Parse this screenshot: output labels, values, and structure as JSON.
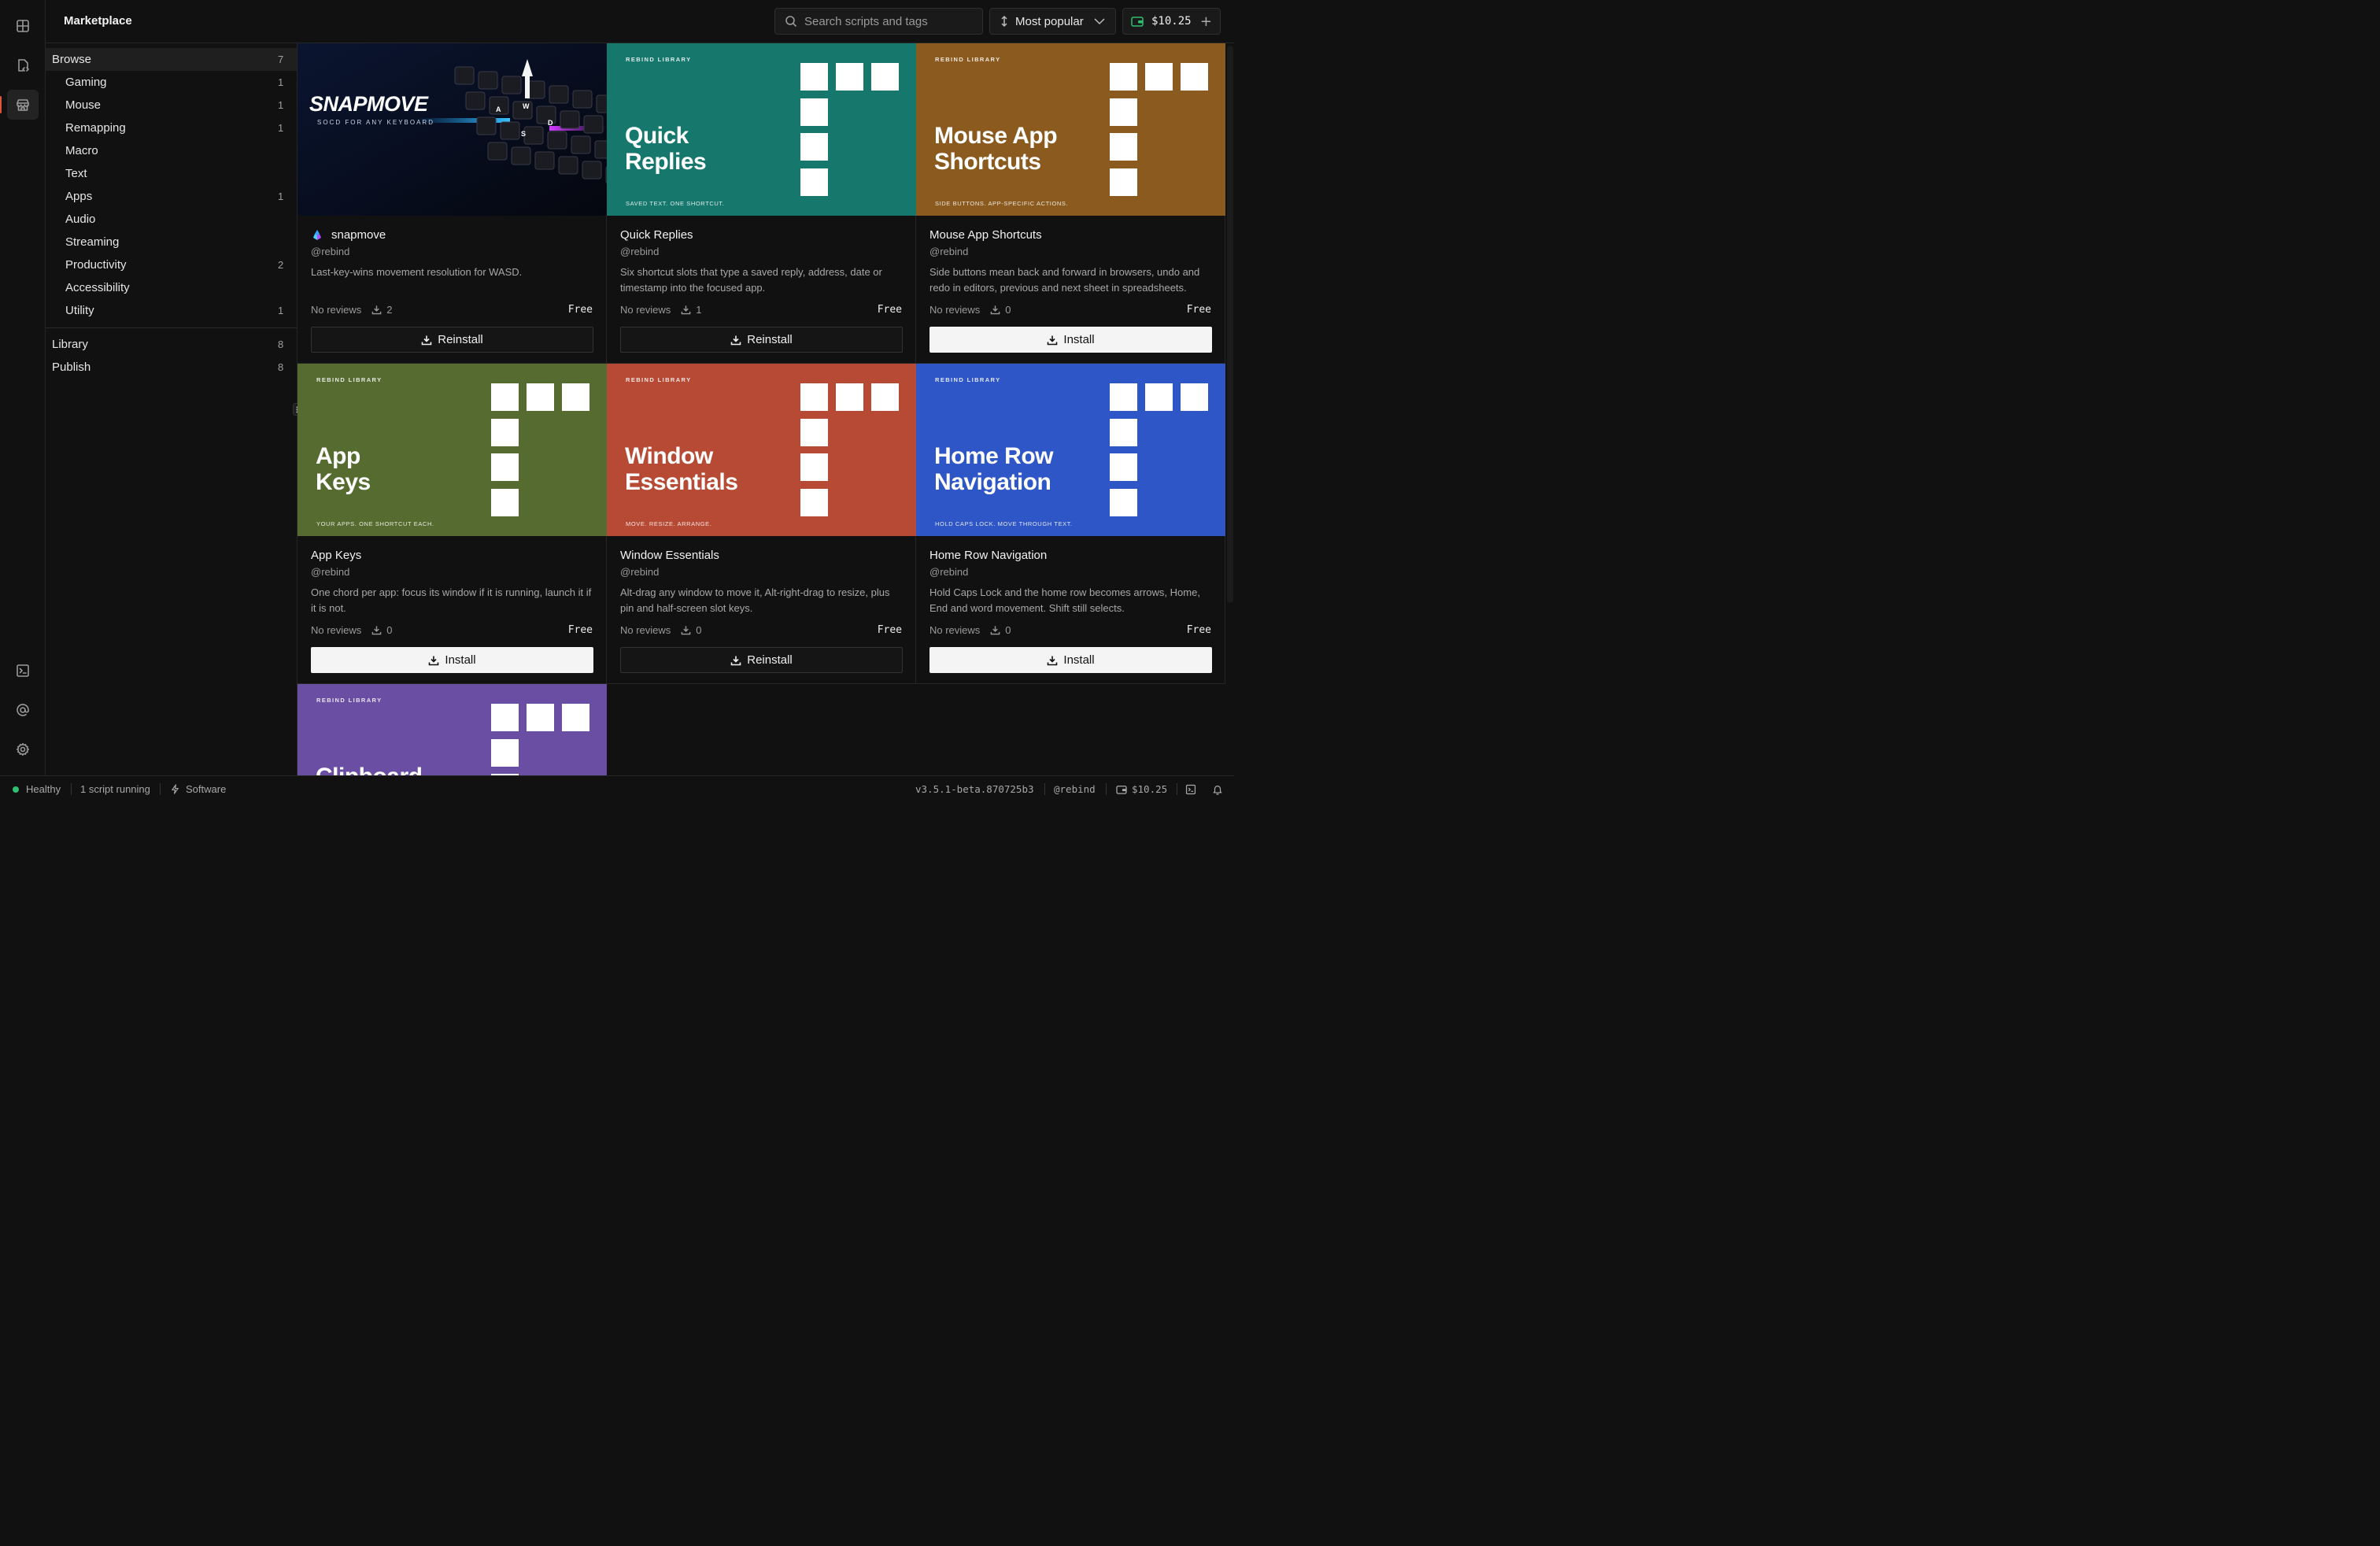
{
  "app": {
    "page_title": "Marketplace"
  },
  "rail": {
    "top_icons": [
      "grid-icon",
      "script-edit-icon",
      "store-icon"
    ],
    "bottom_icons": [
      "terminal-icon",
      "at-icon",
      "settings-icon"
    ],
    "active": "store-icon",
    "accent_color": "#e0563b"
  },
  "topbar": {
    "search_placeholder": "Search scripts and tags",
    "sort_label": "Most popular",
    "wallet_amount": "$10.25",
    "wallet_plus": "+"
  },
  "sidebar": {
    "browse": {
      "label": "Browse",
      "count": "7"
    },
    "categories": [
      {
        "label": "Gaming",
        "count": "1"
      },
      {
        "label": "Mouse",
        "count": "1"
      },
      {
        "label": "Remapping",
        "count": "1"
      },
      {
        "label": "Macro",
        "count": ""
      },
      {
        "label": "Text",
        "count": ""
      },
      {
        "label": "Apps",
        "count": "1"
      },
      {
        "label": "Audio",
        "count": ""
      },
      {
        "label": "Streaming",
        "count": ""
      },
      {
        "label": "Productivity",
        "count": "2"
      },
      {
        "label": "Accessibility",
        "count": ""
      },
      {
        "label": "Utility",
        "count": "1"
      }
    ],
    "library": {
      "label": "Library",
      "count": "8"
    },
    "publish": {
      "label": "Publish",
      "count": "8"
    }
  },
  "cards": [
    {
      "title": "snapmove",
      "author": "@rebind",
      "description": "Last-key-wins movement resolution for WASD.",
      "reviews": "No reviews",
      "installs": "2",
      "price": "Free",
      "action": "Reinstall",
      "banner": {
        "style": "keyboard",
        "logo": "SNAPMOVE",
        "tagline": "SOCD FOR ANY KEYBOARD",
        "keys": [
          "W",
          "A",
          "S",
          "D"
        ]
      }
    },
    {
      "title": "Quick Replies",
      "author": "@rebind",
      "description": "Six shortcut slots that type a saved reply, address, date or timestamp into the focused app.",
      "reviews": "No reviews",
      "installs": "1",
      "price": "Free",
      "action": "Reinstall",
      "banner": {
        "style": "library",
        "bg": "#16776c",
        "tag": "REBIND LIBRARY",
        "heading_lines": [
          "Quick",
          "Replies"
        ],
        "subtag": "SAVED TEXT. ONE SHORTCUT."
      }
    },
    {
      "title": "Mouse App Shortcuts",
      "author": "@rebind",
      "description": "Side buttons mean back and forward in browsers, undo and redo in editors, previous and next sheet in spreadsheets.",
      "reviews": "No reviews",
      "installs": "0",
      "price": "Free",
      "action": "Install",
      "banner": {
        "style": "library",
        "bg": "#8a5a1f",
        "tag": "REBIND LIBRARY",
        "heading_lines": [
          "Mouse App",
          "Shortcuts"
        ],
        "subtag": "SIDE BUTTONS. APP-SPECIFIC ACTIONS."
      }
    },
    {
      "title": "App Keys",
      "author": "@rebind",
      "description": "One chord per app: focus its window if it is running, launch it if it is not.",
      "reviews": "No reviews",
      "installs": "0",
      "price": "Free",
      "action": "Install",
      "banner": {
        "style": "library",
        "bg": "#566b30",
        "tag": "REBIND LIBRARY",
        "heading_lines": [
          "App",
          "Keys"
        ],
        "subtag": "YOUR APPS. ONE SHORTCUT EACH."
      }
    },
    {
      "title": "Window Essentials",
      "author": "@rebind",
      "description": "Alt-drag any window to move it, Alt-right-drag to resize, plus pin and half-screen slot keys.",
      "reviews": "No reviews",
      "installs": "0",
      "price": "Free",
      "action": "Reinstall",
      "banner": {
        "style": "library",
        "bg": "#b74a35",
        "tag": "REBIND LIBRARY",
        "heading_lines": [
          "Window",
          "Essentials"
        ],
        "subtag": "MOVE. RESIZE. ARRANGE."
      }
    },
    {
      "title": "Home Row Navigation",
      "author": "@rebind",
      "description": "Hold Caps Lock and the home row becomes arrows, Home, End and word movement. Shift still selects.",
      "reviews": "No reviews",
      "installs": "0",
      "price": "Free",
      "action": "Install",
      "banner": {
        "style": "library",
        "bg": "#2f56c6",
        "tag": "REBIND LIBRARY",
        "heading_lines": [
          "Home Row",
          "Navigation"
        ],
        "subtag": "HOLD CAPS LOCK. MOVE THROUGH TEXT."
      }
    },
    {
      "title": "",
      "author": "",
      "description": "",
      "reviews": "",
      "installs": "",
      "price": "",
      "action": "",
      "banner": {
        "style": "library",
        "bg": "#6a4ea4",
        "tag": "REBIND LIBRARY",
        "heading_lines": [
          "Clipboard",
          ""
        ],
        "subtag": ""
      }
    }
  ],
  "status": {
    "health": "Healthy",
    "health_color": "#2fbf71",
    "scripts": "1 script running",
    "mode": "Software",
    "version": "v3.5.1-beta.870725b3",
    "user": "@rebind",
    "wallet": "$10.25"
  }
}
